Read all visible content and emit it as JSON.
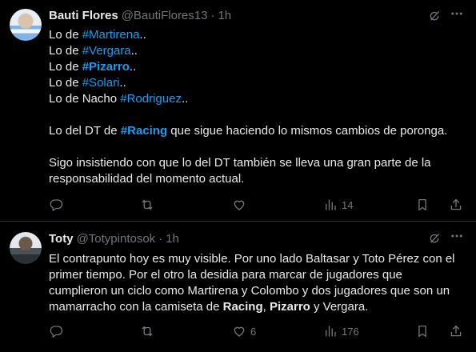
{
  "tweets": [
    {
      "name": "Bauti Flores",
      "handle": "@BautiFlores13",
      "separator": "·",
      "time": "1h",
      "lines": [
        [
          {
            "t": "Lo de "
          },
          {
            "t": "#Martirena",
            "s": "tag"
          },
          {
            "t": ".."
          }
        ],
        [
          {
            "t": "Lo de "
          },
          {
            "t": "#Vergara",
            "s": "tag"
          },
          {
            "t": ".."
          }
        ],
        [
          {
            "t": "Lo de "
          },
          {
            "t": "#Pizarro",
            "s": "tag b"
          },
          {
            "t": ".."
          }
        ],
        [
          {
            "t": "Lo de "
          },
          {
            "t": "#Solari",
            "s": "tag"
          },
          {
            "t": ".."
          }
        ],
        [
          {
            "t": "Lo de Nacho "
          },
          {
            "t": "#Rodriguez",
            "s": "tag"
          },
          {
            "t": ".."
          }
        ],
        [],
        [
          {
            "t": "Lo del DT de "
          },
          {
            "t": "#Racing",
            "s": "tag b"
          },
          {
            "t": " que sigue haciendo lo mismos cambios de poronga."
          }
        ],
        [],
        [
          {
            "t": "Sigo insistiendo con que lo del DT también se lleva una gran parte de la"
          }
        ],
        [
          {
            "t": "responsabilidad del momento actual."
          }
        ]
      ],
      "replies": "",
      "retweets": "",
      "likes": "",
      "views": "14"
    },
    {
      "name": "Toty",
      "handle": "@Totypintosok",
      "separator": "·",
      "time": "1h",
      "lines": [
        [
          {
            "t": "El contrapunto hoy es muy visible. Por uno lado Baltasar y Toto Pérez con el"
          }
        ],
        [
          {
            "t": "primer tiempo. Por el otro la desidia para marcar de jugadores que"
          }
        ],
        [
          {
            "t": "cumplieron un ciclo como Martirena y Colombo y dos jugadores que son un"
          }
        ],
        [
          {
            "t": "mamarracho con la camiseta de "
          },
          {
            "t": "Racing",
            "s": "b"
          },
          {
            "t": ", "
          },
          {
            "t": "Pizarro",
            "s": "b"
          },
          {
            "t": " y Vergara."
          }
        ]
      ],
      "replies": "",
      "retweets": "",
      "likes": "6",
      "views": "176"
    }
  ],
  "icons": {
    "grok": "grok-icon",
    "more": "more-icon",
    "reply": "reply-icon",
    "retweet": "retweet-icon",
    "like": "like-icon",
    "views": "views-icon",
    "bookmark": "bookmark-icon",
    "share": "share-icon"
  },
  "colors": {
    "background": "#000000",
    "text": "#e7e9ea",
    "muted": "#71767b",
    "hashtag": "#1d9bf0",
    "divider": "#2f3336"
  }
}
